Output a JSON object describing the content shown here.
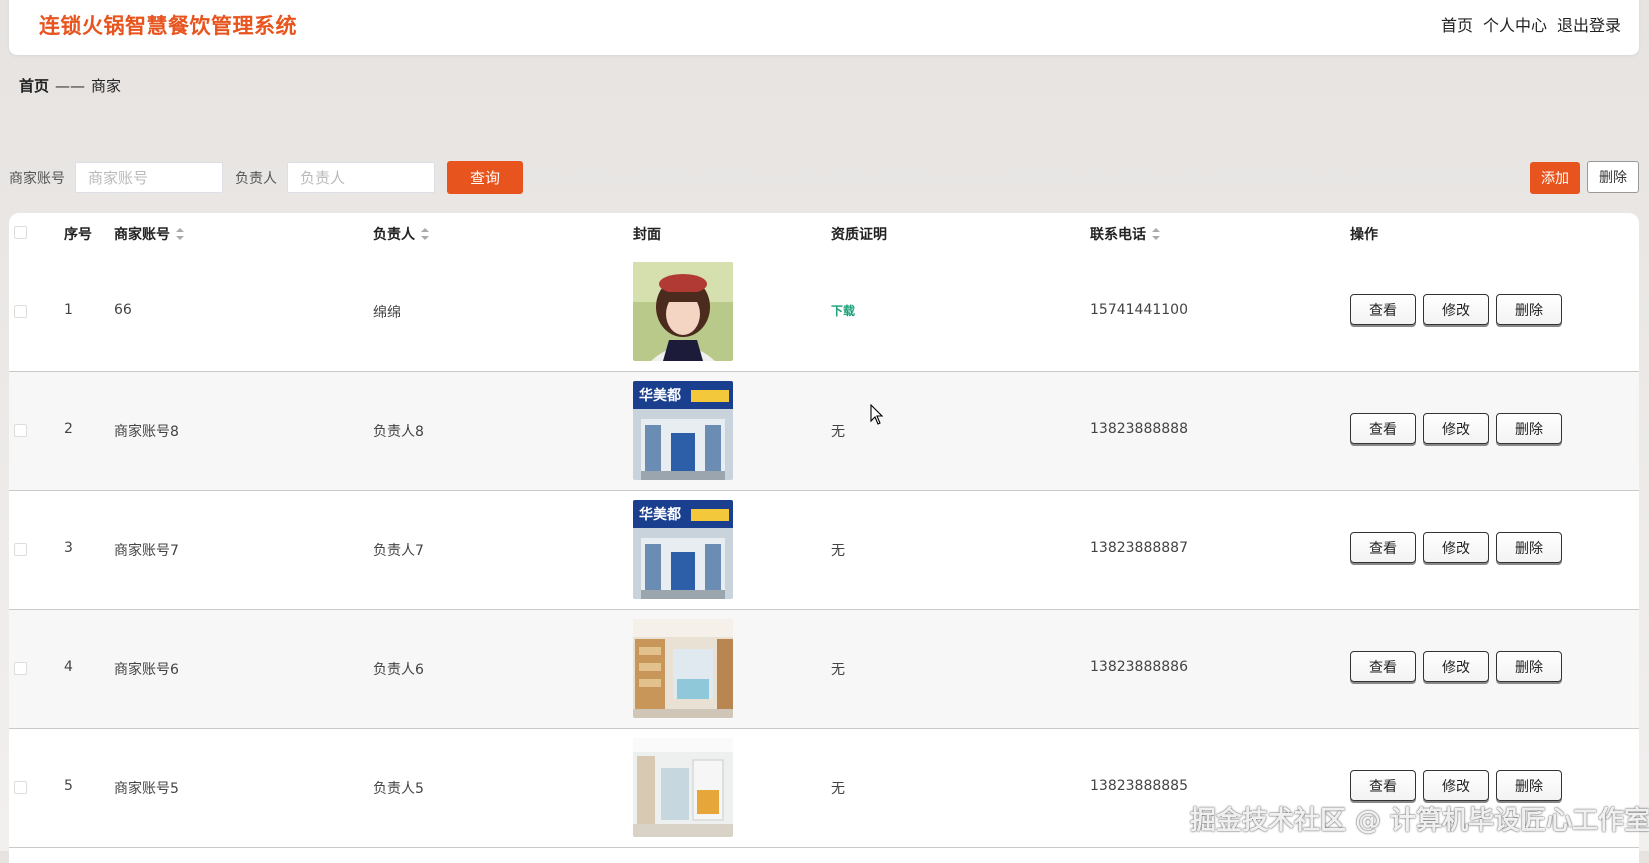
{
  "app": {
    "title": "连锁火锅智慧餐饮管理系统"
  },
  "topnav": {
    "home": "首页",
    "profile": "个人中心",
    "logout": "退出登录"
  },
  "breadcrumb": {
    "home": "首页",
    "separator": "——",
    "current": "商家"
  },
  "search": {
    "account_label": "商家账号",
    "account_placeholder": "商家账号",
    "owner_label": "负责人",
    "owner_placeholder": "负责人",
    "query_button": "查询"
  },
  "toolbar": {
    "add_button": "添加",
    "delete_button": "删除"
  },
  "table": {
    "headers": {
      "index": "序号",
      "account": "商家账号",
      "owner": "负责人",
      "cover": "封面",
      "qualification": "资质证明",
      "phone": "联系电话",
      "actions": "操作"
    },
    "action_labels": {
      "view": "查看",
      "edit": "修改",
      "delete": "删除"
    },
    "rows": [
      {
        "index": "1",
        "account": "66",
        "owner": "绵绵",
        "cover": "girl-portrait",
        "qualification": "下载",
        "qualification_is_link": true,
        "phone": "15741441100"
      },
      {
        "index": "2",
        "account": "商家账号8",
        "owner": "负责人8",
        "cover": "storefront-blue",
        "qualification": "无",
        "qualification_is_link": false,
        "phone": "13823888888"
      },
      {
        "index": "3",
        "account": "商家账号7",
        "owner": "负责人7",
        "cover": "storefront-blue",
        "qualification": "无",
        "qualification_is_link": false,
        "phone": "13823888887"
      },
      {
        "index": "4",
        "account": "商家账号6",
        "owner": "负责人6",
        "cover": "shop-interior-warm",
        "qualification": "无",
        "qualification_is_link": false,
        "phone": "13823888886"
      },
      {
        "index": "5",
        "account": "商家账号5",
        "owner": "负责人5",
        "cover": "shop-interior-light",
        "qualification": "无",
        "qualification_is_link": false,
        "phone": "13823888885"
      }
    ]
  },
  "watermark": {
    "text": "掘金技术社区 @ 计算机毕设匠心工作室"
  },
  "colors": {
    "accent": "#e8541e",
    "link": "#1aa07a"
  }
}
